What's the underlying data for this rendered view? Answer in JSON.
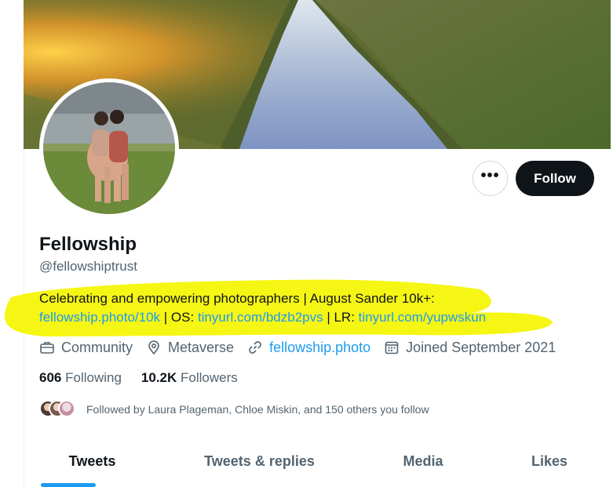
{
  "profile": {
    "display_name": "Fellowship",
    "handle": "@fellowshiptrust",
    "bio_line1": "Celebrating and empowering photographers | August Sander 10k+:",
    "bio_link1": "fellowship.photo/10k",
    "bio_sep1": " | OS: ",
    "bio_link2": "tinyurl.com/bdzb2pvs",
    "bio_sep2": " | LR: ",
    "bio_link3": "tinyurl.com/yupwskun"
  },
  "actions": {
    "more_label": "•••",
    "follow_label": "Follow"
  },
  "meta": {
    "category": "Community",
    "location": "Metaverse",
    "website": "fellowship.photo",
    "joined": "Joined September 2021"
  },
  "stats": {
    "following_count": "606",
    "following_label": "Following",
    "followers_count": "10.2K",
    "followers_label": "Followers"
  },
  "followed_by": {
    "text": "Followed by Laura Plageman, Chloe Miskin, and 150 others you follow"
  },
  "tabs": [
    {
      "label": "Tweets",
      "active": true
    },
    {
      "label": "Tweets & replies",
      "active": false
    },
    {
      "label": "Media",
      "active": false
    },
    {
      "label": "Likes",
      "active": false
    }
  ],
  "colors": {
    "accent": "#1d9bf0",
    "text_primary": "#0f1419",
    "text_secondary": "#536471",
    "highlighter": "#f5f500"
  },
  "icons": {
    "category": "briefcase-icon",
    "location": "location-pin-icon",
    "website": "link-icon",
    "joined": "calendar-icon"
  }
}
